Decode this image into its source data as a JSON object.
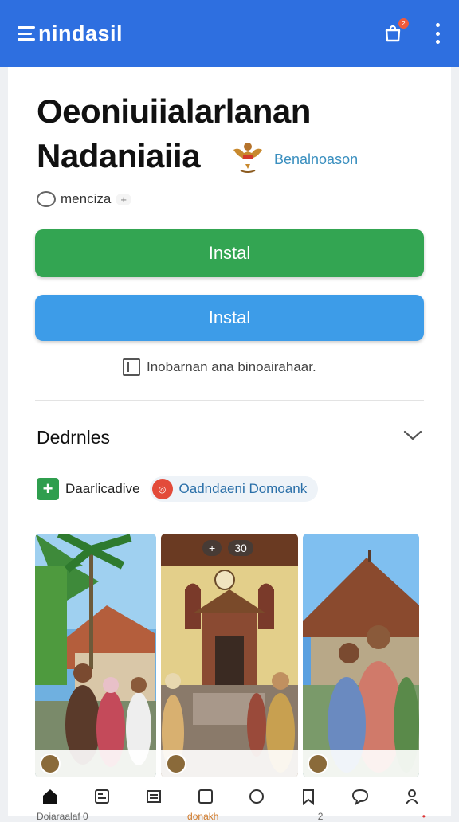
{
  "appbar": {
    "brand": "nindasil",
    "notification_count": "2",
    "icons": {
      "menu_mark": "hamburger-logo-icon",
      "notif": "bag-notification-icon",
      "more": "more-vertical-icon"
    }
  },
  "app": {
    "title_line1": "Oeoniuiialarlanan",
    "title_line2": "Nadaniaiia",
    "developer": "Benalnoason",
    "rating_text": "menciza",
    "rating_extra": "+"
  },
  "buttons": {
    "install_primary": "Instal",
    "install_secondary": "Instal"
  },
  "info": {
    "text": "Inobarnan ana binoairahaar."
  },
  "details": {
    "section_title": "Dedrnles",
    "chip1_label": "Daarlicadive",
    "chip2_label": "Oadndaeni Domoank"
  },
  "screenshots": {
    "overlay_plus": "+",
    "overlay_count": "30"
  },
  "bottom_nav": {
    "labels": [
      "Doiaraalaf 0",
      "donakh",
      "2",
      "•"
    ]
  },
  "colors": {
    "appbar": "#2e6fe0",
    "install_green": "#33a552",
    "install_blue": "#3d9ce8",
    "developer_link": "#3a8fbf"
  }
}
